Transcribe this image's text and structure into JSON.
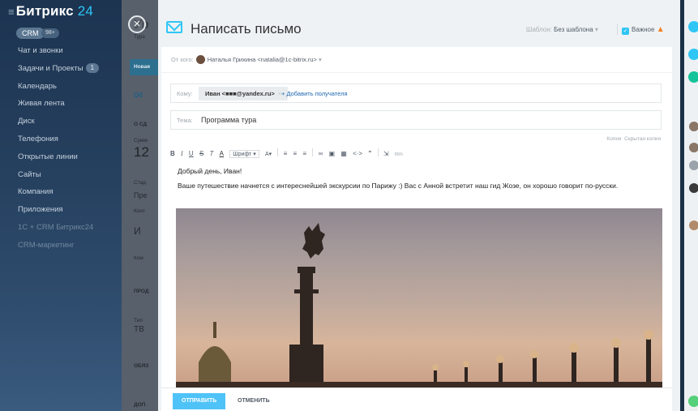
{
  "sidebar": {
    "logo": "Битрикс",
    "logo_num": "24",
    "crm_label": "CRM",
    "crm_count": "98+",
    "items": [
      {
        "label": "Чат и звонки",
        "badge": ""
      },
      {
        "label": "Задачи и Проекты",
        "badge": "1"
      },
      {
        "label": "Календарь",
        "badge": ""
      },
      {
        "label": "Живая лента",
        "badge": ""
      },
      {
        "label": "Диск",
        "badge": ""
      },
      {
        "label": "Телефония",
        "badge": ""
      },
      {
        "label": "Открытые линии",
        "badge": ""
      },
      {
        "label": "Сайты",
        "badge": ""
      },
      {
        "label": "Компания",
        "badge": ""
      },
      {
        "label": "Приложения",
        "badge": ""
      },
      {
        "label": "1С + CRM Битрикс24",
        "badge": ""
      },
      {
        "label": "CRM-маркетинг",
        "badge": ""
      }
    ]
  },
  "crm_bg": {
    "title_fragment": "Ур",
    "sub": "Турэ",
    "tab_new": "Новая",
    "tab_ob": "Об",
    "o_sd": "О СД",
    "sum": "Сумм",
    "big_number": "12",
    "stage": "Стад",
    "pre": "Пре",
    "kont": "Конт",
    "init": "И",
    "kom": "Ком",
    "prod": "ПРОД",
    "tip": "Тип",
    "tv": "ТВ",
    "obya": "ОБЯЗ",
    "dop": "ДОП"
  },
  "panel": {
    "title": "Написать письмо",
    "template_label": "Шаблон:",
    "template_value": "Без шаблона",
    "important_label": "Важное"
  },
  "form": {
    "from_label": "От кого:",
    "from_value": "Наталья Грихина <natalia@1c-bitrix.ru>",
    "to_label": "Кому:",
    "recipient": "Иван <■■■@yandex.ru>",
    "add_recipient": "+ Добавить получателя",
    "subject_label": "Тема:",
    "subject_value": "Программа тура",
    "copy": "Копия",
    "hidden_copy": "Скрытая копия"
  },
  "toolbar": {
    "bold": "B",
    "italic": "I",
    "underline": "U",
    "strike": "S",
    "clear": "T",
    "color": "A",
    "font": "Шрифт",
    "size": "A",
    "html": "htm"
  },
  "body": {
    "greeting": "Добрый день, Иван!",
    "paragraph": "Ваше путешествие начнется с интереснейшей экскурсии по Парижу :) Вас с Анной встретит наш гид Жозе, он хорошо говорит по-русски."
  },
  "footer": {
    "send": "ОТПРАВИТЬ",
    "cancel": "ОТМЕНИТЬ"
  },
  "colors": {
    "accent": "#2fc6f6",
    "link": "#2067b0",
    "send_button": "#4fc3f7"
  }
}
